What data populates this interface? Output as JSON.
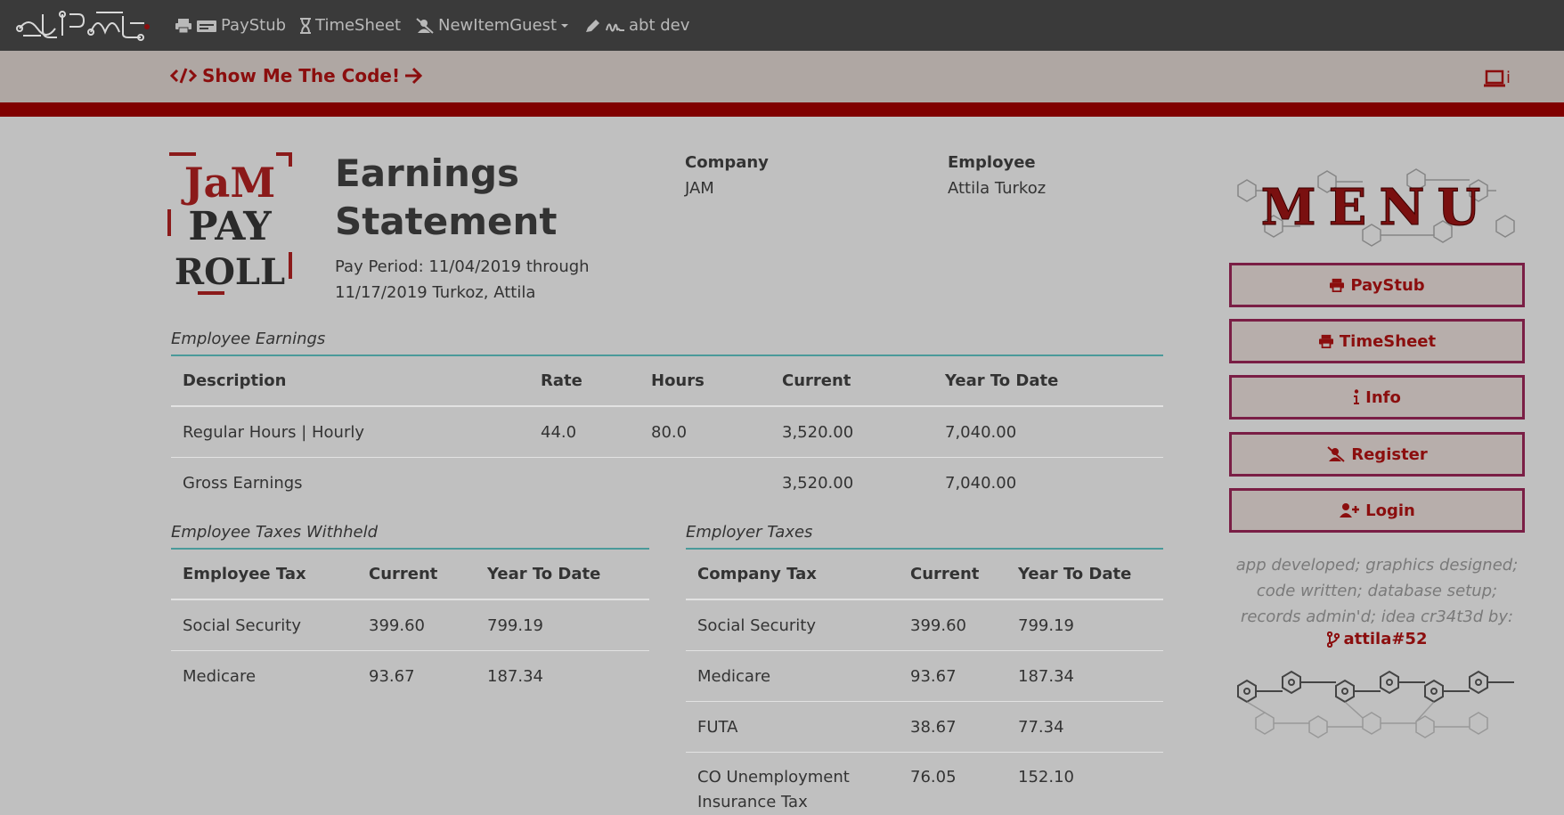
{
  "nav": {
    "paystub": "PayStub",
    "timesheet": "TimeSheet",
    "newitem": "NewItemGuest",
    "abtdev": "abt dev"
  },
  "codebar": {
    "link": "Show Me The Code!",
    "device_label": "i"
  },
  "statement": {
    "logo_text": "JaM PAY ROLL",
    "title_line1": "Earnings",
    "title_line2": "Statement",
    "period_line1": "Pay Period: 11/04/2019 through",
    "period_line2": "11/17/2019 Turkoz, Attila",
    "company_label": "Company",
    "company_value": "JAM",
    "employee_label": "Employee",
    "employee_value": "Attila Turkoz"
  },
  "earnings": {
    "title": "Employee Earnings",
    "headers": [
      "Description",
      "Rate",
      "Hours",
      "Current",
      "Year To Date"
    ],
    "rows": [
      [
        "Regular Hours | Hourly",
        "44.0",
        "80.0",
        "3,520.00",
        "7,040.00"
      ],
      [
        "Gross Earnings",
        "",
        "",
        "3,520.00",
        "7,040.00"
      ]
    ]
  },
  "employee_taxes": {
    "title": "Employee Taxes Withheld",
    "headers": [
      "Employee Tax",
      "Current",
      "Year To Date"
    ],
    "rows": [
      [
        "Social Security",
        "399.60",
        "799.19"
      ],
      [
        "Medicare",
        "93.67",
        "187.34"
      ]
    ]
  },
  "employer_taxes": {
    "title": "Employer Taxes",
    "headers": [
      "Company Tax",
      "Current",
      "Year To Date"
    ],
    "rows": [
      [
        "Social Security",
        "399.60",
        "799.19"
      ],
      [
        "Medicare",
        "93.67",
        "187.34"
      ],
      [
        "FUTA",
        "38.67",
        "77.34"
      ],
      [
        "CO Unemployment Insurance Tax",
        "76.05",
        "152.10"
      ]
    ]
  },
  "menu": {
    "logo_text": "MENU",
    "buttons": [
      "PayStub",
      "TimeSheet",
      "Info",
      "Register",
      "Login"
    ],
    "credits": [
      "app developed; graphics designed;",
      "code written; database setup;",
      "records admin'd; idea cr34t3d by:"
    ],
    "author": "attila#52"
  },
  "colors": {
    "navbar": "#3a3a3a",
    "accent": "#8b0e0e",
    "redbar": "#800000",
    "background": "#c0c0c0",
    "button_border": "#7a1e45",
    "section_rule": "#4a9a9a"
  }
}
